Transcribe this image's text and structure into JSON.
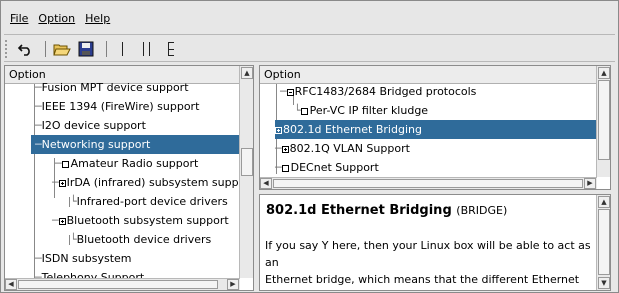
{
  "menu": {
    "file": "File",
    "option": "Option",
    "help": "Help"
  },
  "toolbar": {
    "back": "back-icon",
    "load": "open-folder-icon",
    "save": "save-icon",
    "single_view": "single-view-icon",
    "split_view": "split-view-icon",
    "full_view": "full-view-icon"
  },
  "left_pane": {
    "header": "Option",
    "items": [
      {
        "label": "Fusion MPT device support"
      },
      {
        "label": "IEEE 1394 (FireWire) support"
      },
      {
        "label": "I2O device support"
      },
      {
        "label": "Networking support",
        "selected": true
      },
      {
        "label": "Amateur Radio support"
      },
      {
        "label": "IrDA (infrared) subsystem supp"
      },
      {
        "label": "Infrared-port device drivers"
      },
      {
        "label": "Bluetooth subsystem support"
      },
      {
        "label": "Bluetooth device drivers"
      },
      {
        "label": "ISDN subsystem"
      },
      {
        "label": "Telephony Support"
      }
    ]
  },
  "right_pane": {
    "header": "Option",
    "items": [
      {
        "label": "RFC1483/2684 Bridged protocols"
      },
      {
        "label": "Per-VC IP filter kludge"
      },
      {
        "label": "802.1d Ethernet Bridging",
        "selected": true
      },
      {
        "label": "802.1Q VLAN Support"
      },
      {
        "label": "DECnet Support"
      }
    ]
  },
  "help": {
    "title": "802.1d Ethernet Bridging",
    "symbol": "(BRIDGE)",
    "lines": [
      "If you say Y here, then your Linux box will be able to act as",
      "an",
      "Ethernet bridge, which means that the different Ethernet"
    ]
  },
  "colors": {
    "selection": "#2f6b9a",
    "background": "#e7e7e7"
  }
}
